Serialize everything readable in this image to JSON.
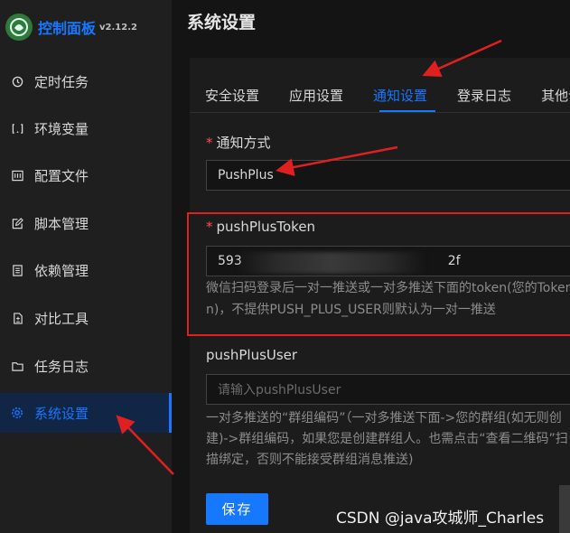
{
  "app": {
    "title": "控制面板",
    "version": "v2.12.2"
  },
  "sidebar": {
    "items": [
      {
        "label": "定时任务",
        "icon": "clock-icon"
      },
      {
        "label": "环境变量",
        "icon": "variable-icon"
      },
      {
        "label": "配置文件",
        "icon": "config-file-icon"
      },
      {
        "label": "脚本管理",
        "icon": "edit-icon"
      },
      {
        "label": "依赖管理",
        "icon": "package-icon"
      },
      {
        "label": "对比工具",
        "icon": "diff-icon"
      },
      {
        "label": "任务日志",
        "icon": "folder-icon"
      },
      {
        "label": "系统设置",
        "icon": "gear-icon",
        "active": true
      }
    ]
  },
  "header": {
    "title": "系统设置"
  },
  "tabs": [
    {
      "label": "安全设置"
    },
    {
      "label": "应用设置"
    },
    {
      "label": "通知设置",
      "active": true
    },
    {
      "label": "登录日志"
    },
    {
      "label": "其他设置"
    }
  ],
  "form": {
    "notify_method": {
      "label": "通知方式",
      "value": "PushPlus"
    },
    "token": {
      "label": "pushPlusToken",
      "value_start": "593",
      "value_end": "2f",
      "help_line1": "微信扫码登录后一对一推送或一对多推送下面的token(您的Token)",
      "help_line2": "n)，不提供PUSH_PLUS_USER则默认为一对一推送"
    },
    "user": {
      "label": "pushPlusUser",
      "placeholder": "请输入pushPlusUser",
      "help_line1": "一对多推送的“群组编码”（一对多推送下面->您的群组(如无则创",
      "help_line2": "建)->群组编码，如果您是创建群组人。也需点击“查看二维码”扫",
      "help_line3": "描绑定，否则不能接受群组消息推送)"
    },
    "save_label": "保存"
  },
  "watermark": "CSDN @java攻城师_Charles",
  "colors": {
    "accent": "#1677ff",
    "annotation": "#e02020",
    "background": "#141414"
  }
}
